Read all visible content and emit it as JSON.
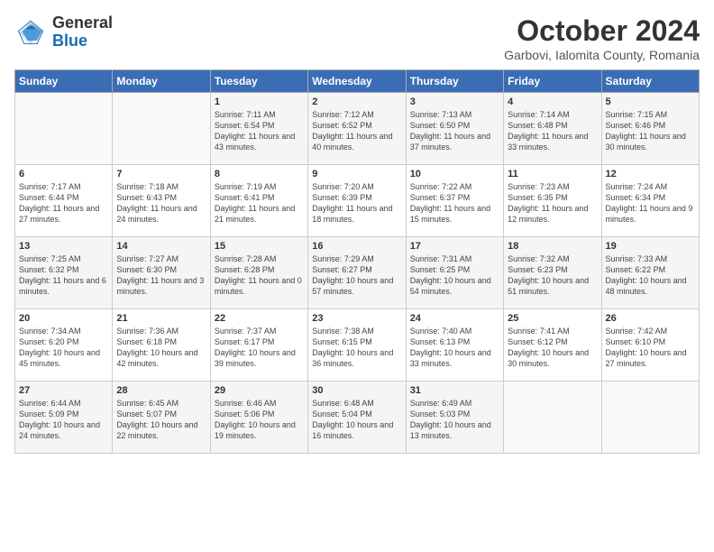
{
  "logo": {
    "general": "General",
    "blue": "Blue"
  },
  "title": "October 2024",
  "location": "Garbovi, Ialomita County, Romania",
  "days_of_week": [
    "Sunday",
    "Monday",
    "Tuesday",
    "Wednesday",
    "Thursday",
    "Friday",
    "Saturday"
  ],
  "weeks": [
    [
      {
        "day": "",
        "sunrise": "",
        "sunset": "",
        "daylight": ""
      },
      {
        "day": "",
        "sunrise": "",
        "sunset": "",
        "daylight": ""
      },
      {
        "day": "1",
        "sunrise": "Sunrise: 7:11 AM",
        "sunset": "Sunset: 6:54 PM",
        "daylight": "Daylight: 11 hours and 43 minutes."
      },
      {
        "day": "2",
        "sunrise": "Sunrise: 7:12 AM",
        "sunset": "Sunset: 6:52 PM",
        "daylight": "Daylight: 11 hours and 40 minutes."
      },
      {
        "day": "3",
        "sunrise": "Sunrise: 7:13 AM",
        "sunset": "Sunset: 6:50 PM",
        "daylight": "Daylight: 11 hours and 37 minutes."
      },
      {
        "day": "4",
        "sunrise": "Sunrise: 7:14 AM",
        "sunset": "Sunset: 6:48 PM",
        "daylight": "Daylight: 11 hours and 33 minutes."
      },
      {
        "day": "5",
        "sunrise": "Sunrise: 7:15 AM",
        "sunset": "Sunset: 6:46 PM",
        "daylight": "Daylight: 11 hours and 30 minutes."
      }
    ],
    [
      {
        "day": "6",
        "sunrise": "Sunrise: 7:17 AM",
        "sunset": "Sunset: 6:44 PM",
        "daylight": "Daylight: 11 hours and 27 minutes."
      },
      {
        "day": "7",
        "sunrise": "Sunrise: 7:18 AM",
        "sunset": "Sunset: 6:43 PM",
        "daylight": "Daylight: 11 hours and 24 minutes."
      },
      {
        "day": "8",
        "sunrise": "Sunrise: 7:19 AM",
        "sunset": "Sunset: 6:41 PM",
        "daylight": "Daylight: 11 hours and 21 minutes."
      },
      {
        "day": "9",
        "sunrise": "Sunrise: 7:20 AM",
        "sunset": "Sunset: 6:39 PM",
        "daylight": "Daylight: 11 hours and 18 minutes."
      },
      {
        "day": "10",
        "sunrise": "Sunrise: 7:22 AM",
        "sunset": "Sunset: 6:37 PM",
        "daylight": "Daylight: 11 hours and 15 minutes."
      },
      {
        "day": "11",
        "sunrise": "Sunrise: 7:23 AM",
        "sunset": "Sunset: 6:35 PM",
        "daylight": "Daylight: 11 hours and 12 minutes."
      },
      {
        "day": "12",
        "sunrise": "Sunrise: 7:24 AM",
        "sunset": "Sunset: 6:34 PM",
        "daylight": "Daylight: 11 hours and 9 minutes."
      }
    ],
    [
      {
        "day": "13",
        "sunrise": "Sunrise: 7:25 AM",
        "sunset": "Sunset: 6:32 PM",
        "daylight": "Daylight: 11 hours and 6 minutes."
      },
      {
        "day": "14",
        "sunrise": "Sunrise: 7:27 AM",
        "sunset": "Sunset: 6:30 PM",
        "daylight": "Daylight: 11 hours and 3 minutes."
      },
      {
        "day": "15",
        "sunrise": "Sunrise: 7:28 AM",
        "sunset": "Sunset: 6:28 PM",
        "daylight": "Daylight: 11 hours and 0 minutes."
      },
      {
        "day": "16",
        "sunrise": "Sunrise: 7:29 AM",
        "sunset": "Sunset: 6:27 PM",
        "daylight": "Daylight: 10 hours and 57 minutes."
      },
      {
        "day": "17",
        "sunrise": "Sunrise: 7:31 AM",
        "sunset": "Sunset: 6:25 PM",
        "daylight": "Daylight: 10 hours and 54 minutes."
      },
      {
        "day": "18",
        "sunrise": "Sunrise: 7:32 AM",
        "sunset": "Sunset: 6:23 PM",
        "daylight": "Daylight: 10 hours and 51 minutes."
      },
      {
        "day": "19",
        "sunrise": "Sunrise: 7:33 AM",
        "sunset": "Sunset: 6:22 PM",
        "daylight": "Daylight: 10 hours and 48 minutes."
      }
    ],
    [
      {
        "day": "20",
        "sunrise": "Sunrise: 7:34 AM",
        "sunset": "Sunset: 6:20 PM",
        "daylight": "Daylight: 10 hours and 45 minutes."
      },
      {
        "day": "21",
        "sunrise": "Sunrise: 7:36 AM",
        "sunset": "Sunset: 6:18 PM",
        "daylight": "Daylight: 10 hours and 42 minutes."
      },
      {
        "day": "22",
        "sunrise": "Sunrise: 7:37 AM",
        "sunset": "Sunset: 6:17 PM",
        "daylight": "Daylight: 10 hours and 39 minutes."
      },
      {
        "day": "23",
        "sunrise": "Sunrise: 7:38 AM",
        "sunset": "Sunset: 6:15 PM",
        "daylight": "Daylight: 10 hours and 36 minutes."
      },
      {
        "day": "24",
        "sunrise": "Sunrise: 7:40 AM",
        "sunset": "Sunset: 6:13 PM",
        "daylight": "Daylight: 10 hours and 33 minutes."
      },
      {
        "day": "25",
        "sunrise": "Sunrise: 7:41 AM",
        "sunset": "Sunset: 6:12 PM",
        "daylight": "Daylight: 10 hours and 30 minutes."
      },
      {
        "day": "26",
        "sunrise": "Sunrise: 7:42 AM",
        "sunset": "Sunset: 6:10 PM",
        "daylight": "Daylight: 10 hours and 27 minutes."
      }
    ],
    [
      {
        "day": "27",
        "sunrise": "Sunrise: 6:44 AM",
        "sunset": "Sunset: 5:09 PM",
        "daylight": "Daylight: 10 hours and 24 minutes."
      },
      {
        "day": "28",
        "sunrise": "Sunrise: 6:45 AM",
        "sunset": "Sunset: 5:07 PM",
        "daylight": "Daylight: 10 hours and 22 minutes."
      },
      {
        "day": "29",
        "sunrise": "Sunrise: 6:46 AM",
        "sunset": "Sunset: 5:06 PM",
        "daylight": "Daylight: 10 hours and 19 minutes."
      },
      {
        "day": "30",
        "sunrise": "Sunrise: 6:48 AM",
        "sunset": "Sunset: 5:04 PM",
        "daylight": "Daylight: 10 hours and 16 minutes."
      },
      {
        "day": "31",
        "sunrise": "Sunrise: 6:49 AM",
        "sunset": "Sunset: 5:03 PM",
        "daylight": "Daylight: 10 hours and 13 minutes."
      },
      {
        "day": "",
        "sunrise": "",
        "sunset": "",
        "daylight": ""
      },
      {
        "day": "",
        "sunrise": "",
        "sunset": "",
        "daylight": ""
      }
    ]
  ]
}
